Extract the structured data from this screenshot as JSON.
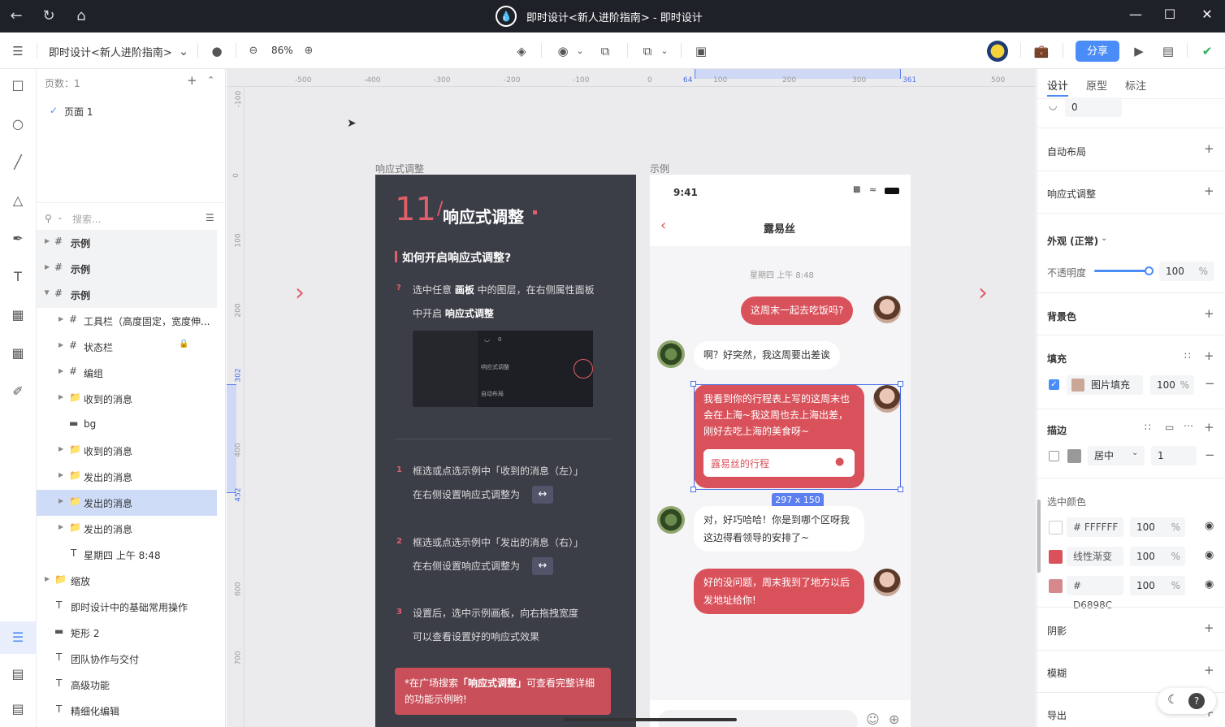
{
  "window": {
    "title": "即时设计<新人进阶指南> - 即时设计"
  },
  "toolbar": {
    "file_name": "即时设计<新人进阶指南>",
    "zoom": "86%",
    "share_label": "分享"
  },
  "layers_panel": {
    "page_count": "页数：1",
    "pages": [
      {
        "label": "页面 1"
      }
    ],
    "search_placeholder": "搜索...",
    "items": [
      {
        "label": "示例"
      },
      {
        "label": "示例"
      },
      {
        "label": "示例"
      },
      {
        "label": "工具栏（高度固定，宽度伸..."
      },
      {
        "label": "状态栏"
      },
      {
        "label": "编组"
      },
      {
        "label": "收到的消息"
      },
      {
        "label": "bg"
      },
      {
        "label": "收到的消息"
      },
      {
        "label": "发出的消息"
      },
      {
        "label": "发出的消息"
      },
      {
        "label": "发出的消息"
      },
      {
        "label": "星期四 上午 8:48"
      },
      {
        "label": "缩放"
      },
      {
        "label": "即时设计中的基础常用操作"
      },
      {
        "label": "矩形 2"
      },
      {
        "label": "团队协作与交付"
      },
      {
        "label": "高级功能"
      },
      {
        "label": "精细化编辑"
      }
    ]
  },
  "rulers": {
    "h_ticks": [
      "-500",
      "-400",
      "-300",
      "-200",
      "-100",
      "0",
      "64",
      "100",
      "200",
      "300",
      "361",
      "500"
    ],
    "v_ticks": [
      "-100",
      "0",
      "100",
      "200",
      "302",
      "400",
      "452",
      "600",
      "700"
    ]
  },
  "canvas": {
    "guide_frame_label": "响应式调整",
    "example_frame_label": "示例",
    "guide": {
      "num": "11",
      "heading": "响应式调整",
      "subheading": "如何开启响应式调整?",
      "step0": {
        "pre": "选中任意 ",
        "b1": "画板",
        "mid": " 中的图层，在右侧属性面板",
        "line2pre": "中开启 ",
        "b2": "响应式调整"
      },
      "thumb_radius": "0",
      "thumb_item1": "响应式调整",
      "thumb_item2": "自动布局",
      "step1": {
        "line1": "框选或点选示例中「收到的消息（左）」",
        "line2": "在右侧设置响应式调整为"
      },
      "step2": {
        "line1": "框选或点选示例中「发出的消息（右）」",
        "line2": "在右侧设置响应式调整为"
      },
      "step3": {
        "line1": "设置后，选中示例画板，向右拖拽宽度",
        "line2": "可以查看设置好的响应式效果"
      },
      "tip": {
        "pre": "*在广场搜索",
        "bold": "「响应式调整」",
        "post": "可查看完整详细的功能示例哟!"
      }
    },
    "example": {
      "status_time": "9:41",
      "nav_title": "露易丝",
      "timestamp": "星期四 上午 8:48",
      "messages": [
        {
          "text": "这周末一起去吃饭吗?"
        },
        {
          "text": "啊？好突然，我这周要出差诶"
        },
        {
          "text": "我看到你的行程表上写的这周末也会在上海~我这周也去上海出差，刚好去吃上海的美食呀~"
        },
        {
          "text": "对，好巧哈哈！你是到哪个区呀我这边得看领导的安排了~"
        },
        {
          "text": "好的没问题，周末我到了地方以后发地址给你!"
        }
      ],
      "card_label": "露易丝的行程",
      "size_badge": "297 x 150"
    }
  },
  "properties": {
    "tabs": [
      "设计",
      "原型",
      "标注"
    ],
    "radius_value": "0",
    "auto_layout": "自动布局",
    "responsive": "响应式调整",
    "appearance": "外观 (正常)",
    "opacity_label": "不透明度",
    "opacity_value": "100",
    "opacity_unit": "%",
    "opacity_level": 1.0,
    "background": "背景色",
    "fill": "填充",
    "fill_type": "图片填充",
    "fill_opacity": "100",
    "stroke": "描边",
    "stroke_align": "居中",
    "stroke_width": "1",
    "selected_colors_label": "选中颜色",
    "selected_colors": [
      {
        "hash": "#",
        "name": "FFFFFF",
        "opacity": "100",
        "swatch": "#FFFFFF"
      },
      {
        "hash": "",
        "name": "线性渐变",
        "opacity": "100",
        "swatch": "#d9525b"
      },
      {
        "hash": "#",
        "name": "D6898C",
        "opacity": "100",
        "swatch": "#D6898C"
      }
    ],
    "shadow": "阴影",
    "blur": "模糊",
    "export": "导出"
  },
  "colors": {
    "accent": "#4b8df8",
    "brand_red": "#d9525b",
    "dark": "#3b3d47"
  }
}
